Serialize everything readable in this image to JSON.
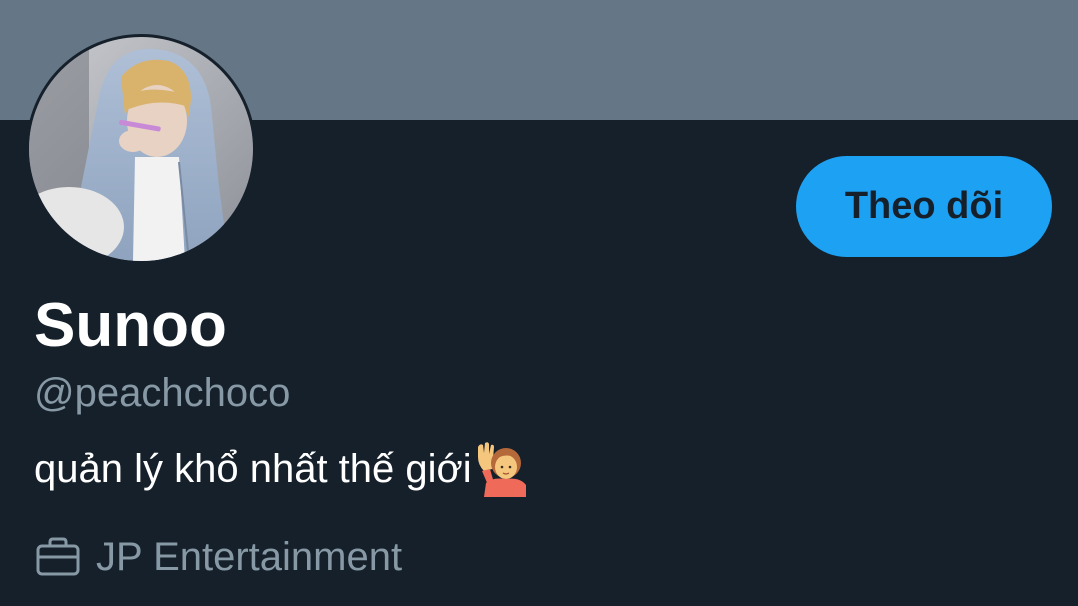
{
  "profile": {
    "display_name": "Sunoo",
    "handle": "@peachchoco",
    "bio": "quản lý khổ nhất thế giới",
    "bio_emoji": "person-raising-hand-emoji",
    "work": "JP Entertainment",
    "work_icon": "briefcase-icon",
    "avatar": "profile-photo"
  },
  "actions": {
    "follow_label": "Theo dõi"
  },
  "colors": {
    "background": "#15202b",
    "banner": "#657786",
    "accent": "#1da1f2",
    "secondary_text": "#8899a6",
    "primary_text": "#ffffff"
  }
}
